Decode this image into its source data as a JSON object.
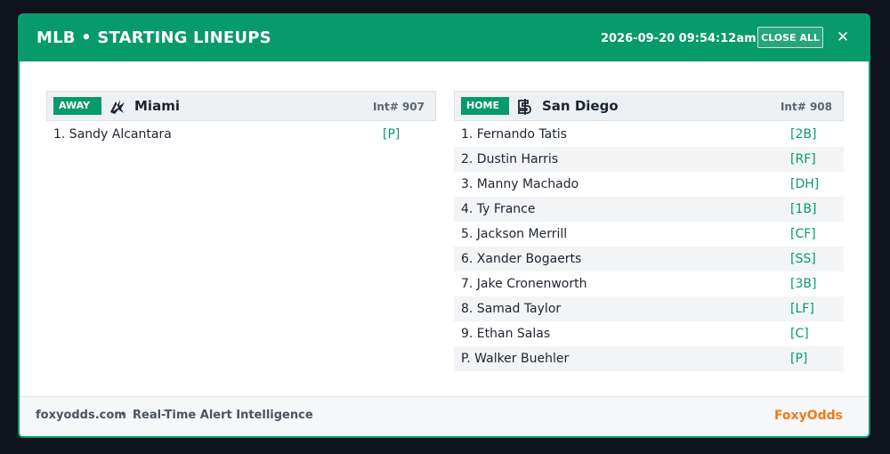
{
  "header": {
    "title": "MLB • STARTING LINEUPS",
    "timestamp": "2026-09-20 09:54:12am",
    "close_all_label": "CLOSE ALL",
    "close_icon": "✕"
  },
  "colors": {
    "accent": "#079a6a",
    "brand": "#f27a17"
  },
  "away": {
    "badge": "AWAY",
    "team": "Miami",
    "logo_icon": "marlins-logo-icon",
    "int": "Int# 907",
    "lineup": [
      {
        "player": "1. Sandy Alcantara",
        "pos": "[P]"
      }
    ]
  },
  "home": {
    "badge": "HOME",
    "team": "San Diego",
    "logo_icon": "padres-logo-icon",
    "int": "Int# 908",
    "lineup": [
      {
        "player": "1. Fernando Tatis",
        "pos": "[2B]"
      },
      {
        "player": "2. Dustin Harris",
        "pos": "[RF]"
      },
      {
        "player": "3. Manny Machado",
        "pos": "[DH]"
      },
      {
        "player": "4. Ty France",
        "pos": "[1B]"
      },
      {
        "player": "5. Jackson Merrill",
        "pos": "[CF]"
      },
      {
        "player": "6. Xander Bogaerts",
        "pos": "[SS]"
      },
      {
        "player": "7. Jake Cronenworth",
        "pos": "[3B]"
      },
      {
        "player": "8. Samad Taylor",
        "pos": "[LF]"
      },
      {
        "player": "9. Ethan Salas",
        "pos": "[C]"
      },
      {
        "player": "P. Walker Buehler",
        "pos": "[P]"
      }
    ]
  },
  "footer": {
    "site": "foxyodds.com",
    "separator": "•",
    "tagline": "Real-Time Alert Intelligence",
    "brand": "FoxyOdds"
  }
}
